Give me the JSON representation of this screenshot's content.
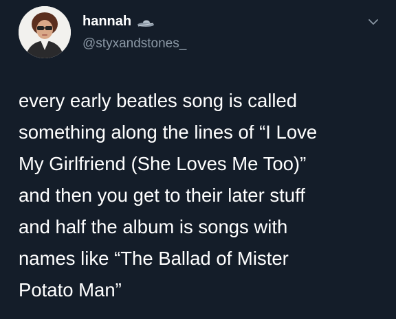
{
  "author": {
    "display_name": "hannah",
    "handle": "@styxandstones_",
    "avatar_icon": "profile-photo",
    "name_emoji_icon": "ufo-icon"
  },
  "menu_icon": "chevron-down-icon",
  "tweet": {
    "lines": [
      "every early beatles song is called",
      "something along the lines of “I Love",
      "My Girlfriend (She Loves Me Too)”",
      "and then you get to their later stuff",
      "and half the album is songs with",
      "names like “The Ballad of Mister",
      "Potato Man”"
    ]
  },
  "colors": {
    "background": "#141d29",
    "text": "#ffffff",
    "secondary_text": "#8b98a5"
  }
}
